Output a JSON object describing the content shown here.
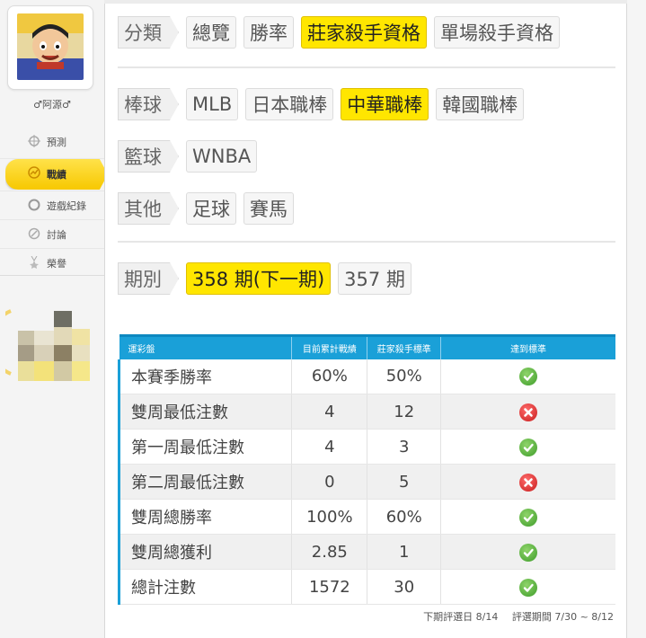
{
  "sidebar": {
    "username": "♂阿源♂",
    "items": [
      {
        "label": "預測",
        "icon": "crosshair-icon",
        "active": false
      },
      {
        "label": "戰績",
        "icon": "chart-icon",
        "active": true
      },
      {
        "label": "遊戲紀錄",
        "icon": "circle-icon",
        "active": false
      },
      {
        "label": "討論",
        "icon": "chat-icon",
        "active": false
      },
      {
        "label": "榮譽",
        "icon": "medal-icon",
        "active": false
      }
    ]
  },
  "filters": {
    "category": {
      "label": "分類",
      "options": [
        {
          "label": "總覽",
          "selected": false
        },
        {
          "label": "勝率",
          "selected": false
        },
        {
          "label": "莊家殺手資格",
          "selected": true
        },
        {
          "label": "單場殺手資格",
          "selected": false
        }
      ]
    },
    "baseball": {
      "label": "棒球",
      "options": [
        {
          "label": "MLB",
          "selected": false
        },
        {
          "label": "日本職棒",
          "selected": false
        },
        {
          "label": "中華職棒",
          "selected": true
        },
        {
          "label": "韓國職棒",
          "selected": false
        }
      ]
    },
    "basketball": {
      "label": "籃球",
      "options": [
        {
          "label": "WNBA",
          "selected": false
        }
      ]
    },
    "other": {
      "label": "其他",
      "options": [
        {
          "label": "足球",
          "selected": false
        },
        {
          "label": "賽馬",
          "selected": false
        }
      ]
    },
    "period": {
      "label": "期別",
      "options": [
        {
          "label": "358 期(下一期)",
          "selected": true
        },
        {
          "label": "357 期",
          "selected": false
        }
      ]
    }
  },
  "table": {
    "headers": [
      "運彩盤",
      "目前累計戰績",
      "莊家殺手標準",
      "達到標準"
    ],
    "rows": [
      {
        "name": "本賽季勝率",
        "current": "60%",
        "standard": "50%",
        "met": true
      },
      {
        "name": "雙周最低注數",
        "current": "4",
        "standard": "12",
        "met": false
      },
      {
        "name": "第一周最低注數",
        "current": "4",
        "standard": "3",
        "met": true
      },
      {
        "name": "第二周最低注數",
        "current": "0",
        "standard": "5",
        "met": false
      },
      {
        "name": "雙周總勝率",
        "current": "100%",
        "standard": "60%",
        "met": true
      },
      {
        "name": "雙周總獲利",
        "current": "2.85",
        "standard": "1",
        "met": true
      },
      {
        "name": "總計注數",
        "current": "1572",
        "standard": "30",
        "met": true
      }
    ]
  },
  "footer": {
    "next_eval": "下期評選日 8/14",
    "eval_period": "評選期間 7/30 ~ 8/12"
  },
  "colors": {
    "selected_chip": "#ffe600",
    "table_header": "#1aa0d8",
    "ok": "#3e9c2a",
    "fail": "#c81e1e"
  }
}
